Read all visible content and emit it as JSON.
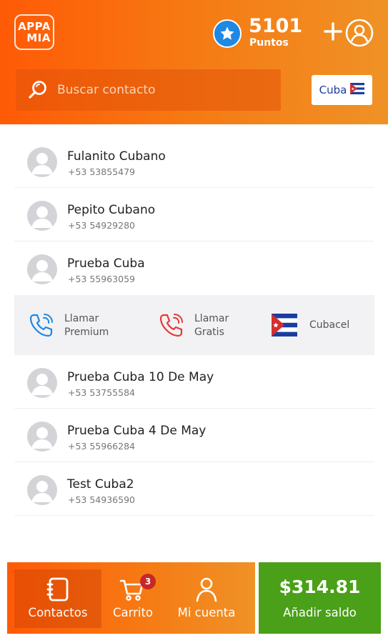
{
  "header": {
    "logo_lines": [
      "APPA",
      "MIA"
    ],
    "points_value": "5101",
    "points_label": "Puntos",
    "star_icon": "star-icon",
    "add_icon": "plus-icon",
    "profile_icon": "user-circle-icon"
  },
  "search": {
    "placeholder": "Buscar contacto",
    "value": ""
  },
  "country": {
    "label": "Cuba",
    "flag_icon": "cuba-flag-icon"
  },
  "contacts_top": [
    {
      "name": "Fulanito Cubano",
      "phone": "+53 53855479"
    },
    {
      "name": "Pepito Cubano",
      "phone": "+53 54929280"
    },
    {
      "name": "Prueba Cuba",
      "phone": "+53 55963059"
    }
  ],
  "actions": {
    "premium": {
      "line1": "Llamar",
      "line2": "Premium",
      "icon": "phone-call-icon",
      "color": "#1e88e5"
    },
    "free": {
      "line1": "Llamar",
      "line2": "Gratis",
      "icon": "phone-call-icon",
      "color": "#e53935"
    },
    "cubacel": {
      "label": "Cubacel",
      "icon": "cuba-flag-icon"
    }
  },
  "contacts_bottom": [
    {
      "name": "Prueba Cuba 10 De May",
      "phone": "+53 53755584"
    },
    {
      "name": "Prueba Cuba 4 De May",
      "phone": "+53 55966284"
    },
    {
      "name": "Test Cuba2",
      "phone": "+53 54936590"
    }
  ],
  "bottom_nav": {
    "contacts_label": "Contactos",
    "cart_label": "Carrito",
    "cart_badge": "3",
    "account_label": "Mi cuenta"
  },
  "balance": {
    "amount": "$314.81",
    "label": "Añadir saldo"
  },
  "colors": {
    "brand_orange": "#ff5a06",
    "balance_green": "#4aa018",
    "badge_red": "#c62828"
  }
}
